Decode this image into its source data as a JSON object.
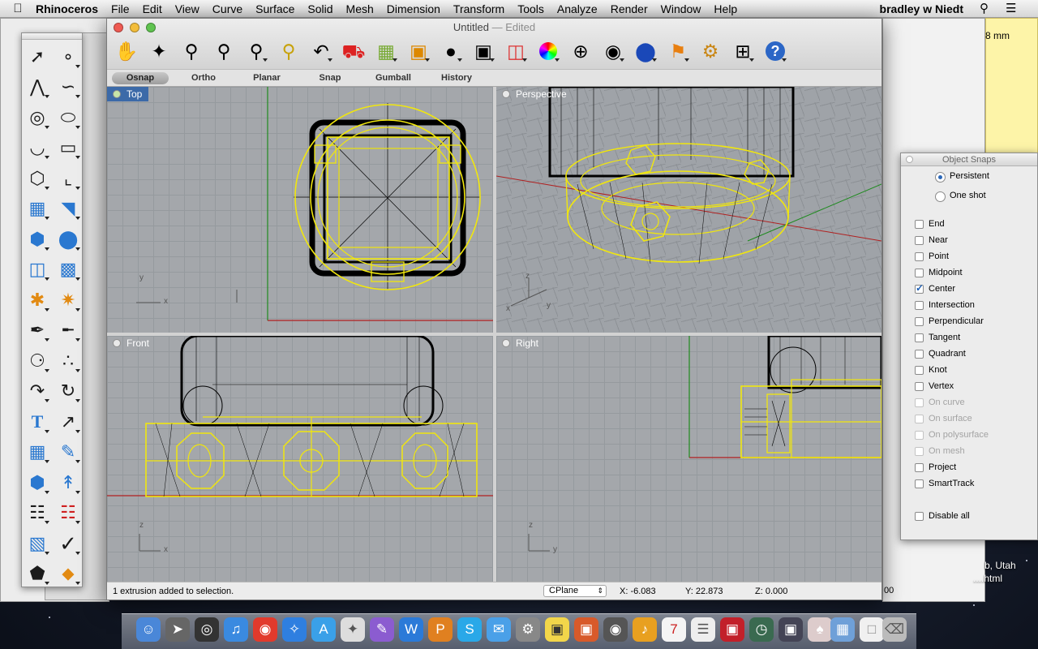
{
  "menubar": {
    "app_name": "Rhinoceros",
    "items": [
      "File",
      "Edit",
      "View",
      "Curve",
      "Surface",
      "Solid",
      "Mesh",
      "Dimension",
      "Transform",
      "Tools",
      "Analyze",
      "Render",
      "Window",
      "Help"
    ],
    "user": "bradley w Niedt"
  },
  "window": {
    "title": "Untitled",
    "edited": "— Edited"
  },
  "toolbar": {
    "icons": [
      "pan-hand-icon",
      "rotate-view-icon",
      "zoom-dynamic-icon",
      "zoom-window-icon",
      "zoom-extents-icon",
      "zoom-selected-icon",
      "undo-view-icon",
      "named-views-car-icon",
      "cplane-grid-icon",
      "set-view-icon",
      "light-bulb-icon",
      "lock-icon",
      "layers-icon",
      "color-wheel-icon",
      "wireframe-sphere-icon",
      "shaded-sphere-icon",
      "rendered-sphere-icon",
      "render-flag-icon",
      "options-gear-icon",
      "snap-grid-icon",
      "help-icon"
    ]
  },
  "status_buttons": [
    "Osnap",
    "Ortho",
    "Planar",
    "Snap",
    "Gumball",
    "History"
  ],
  "viewports": {
    "top": "Top",
    "perspective": "Perspective",
    "front": "Front",
    "right": "Right"
  },
  "axes": {
    "x": "x",
    "y": "y",
    "z": "z"
  },
  "statusbar": {
    "message": "1 extrusion added to selection.",
    "cplane": "CPlane",
    "x": "X: -6.083",
    "y": "Y: 22.873",
    "z": "Z: 0.000",
    "extra": "00"
  },
  "osnap_panel": {
    "title": "Object Snaps",
    "modes": [
      "Persistent",
      "One shot"
    ],
    "snaps": [
      {
        "label": "End",
        "checked": false,
        "enabled": true
      },
      {
        "label": "Near",
        "checked": false,
        "enabled": true
      },
      {
        "label": "Point",
        "checked": false,
        "enabled": true
      },
      {
        "label": "Midpoint",
        "checked": false,
        "enabled": true
      },
      {
        "label": "Center",
        "checked": true,
        "enabled": true
      },
      {
        "label": "Intersection",
        "checked": false,
        "enabled": true
      },
      {
        "label": "Perpendicular",
        "checked": false,
        "enabled": true
      },
      {
        "label": "Tangent",
        "checked": false,
        "enabled": true
      },
      {
        "label": "Quadrant",
        "checked": false,
        "enabled": true
      },
      {
        "label": "Knot",
        "checked": false,
        "enabled": true
      },
      {
        "label": "Vertex",
        "checked": false,
        "enabled": true
      },
      {
        "label": "On curve",
        "checked": false,
        "enabled": false
      },
      {
        "label": "On surface",
        "checked": false,
        "enabled": false
      },
      {
        "label": "On polysurface",
        "checked": false,
        "enabled": false
      },
      {
        "label": "On mesh",
        "checked": false,
        "enabled": false
      },
      {
        "label": "Project",
        "checked": false,
        "enabled": true
      },
      {
        "label": "SmartTrack",
        "checked": false,
        "enabled": true
      }
    ],
    "disable_all": "Disable all"
  },
  "background": {
    "note_text": "8 mm",
    "desktop_text_1": "b, Utah",
    "desktop_text_2": "....html"
  },
  "colors": {
    "selection": "#f0e60e",
    "active_viewport_label": "#3c6aa8",
    "grid_background": "#a4a7ab",
    "x_axis": "#b02020",
    "y_axis": "#1f8a1f"
  }
}
